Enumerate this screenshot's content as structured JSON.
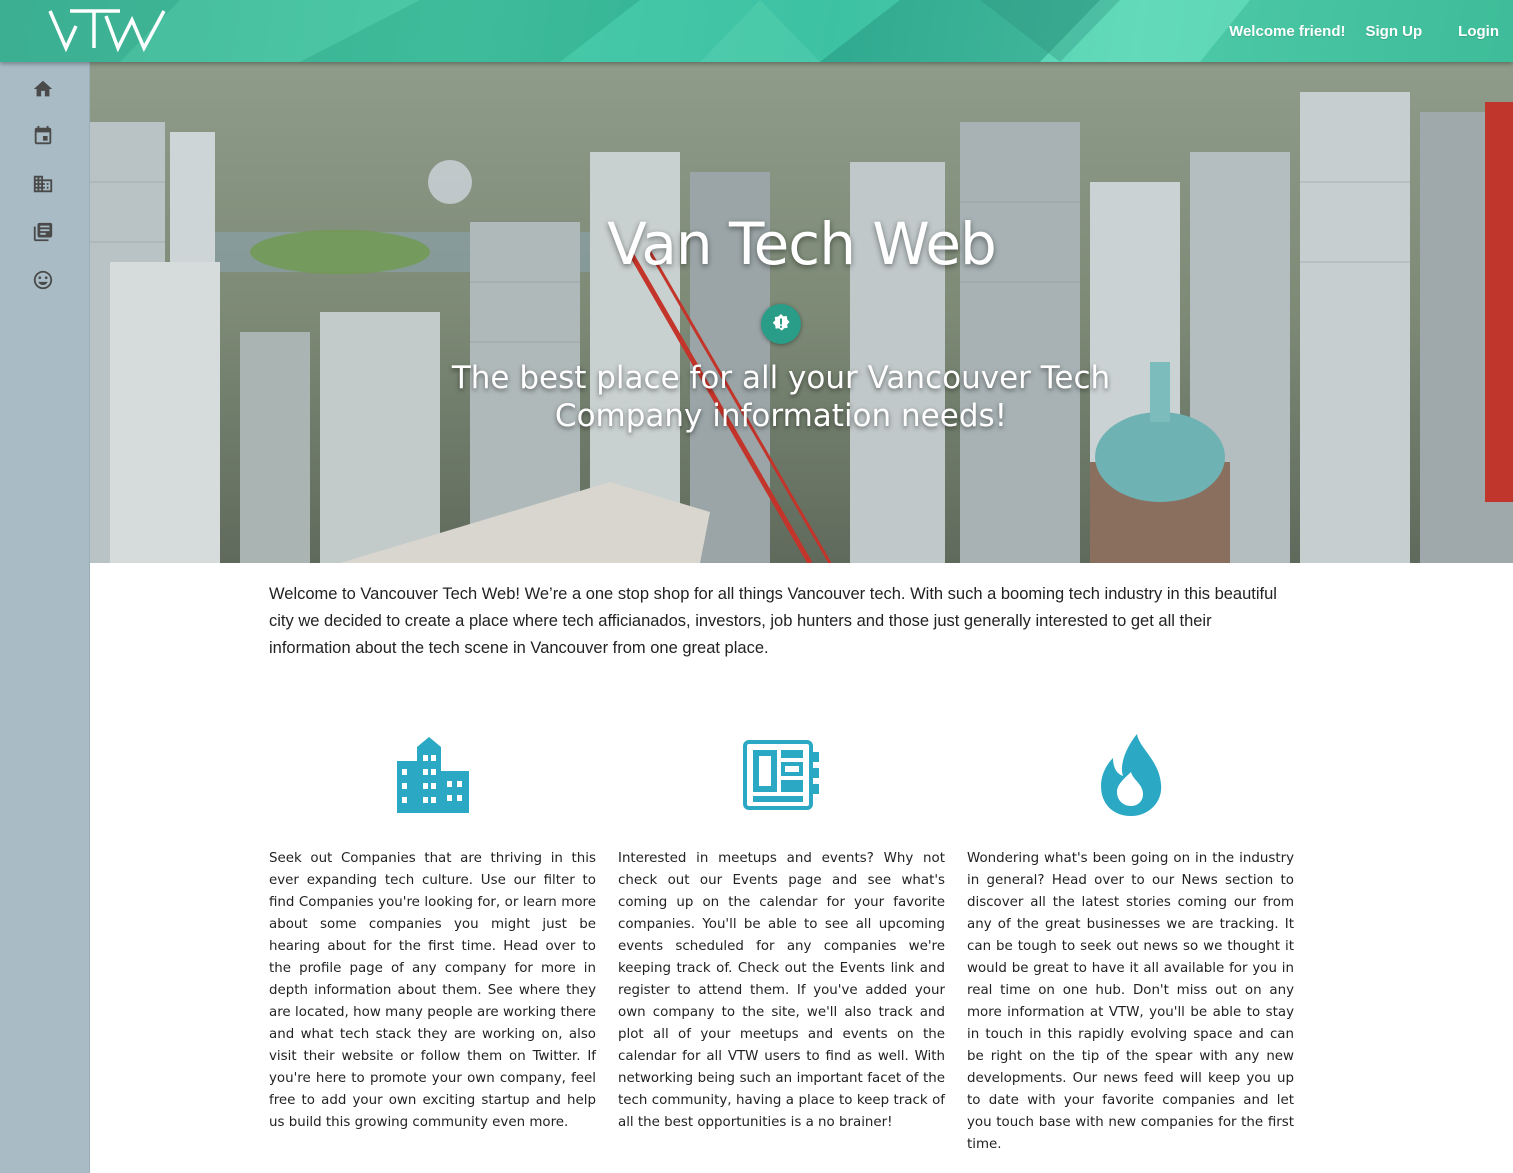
{
  "header": {
    "logo_text": "VTW",
    "welcome": "Welcome friend!",
    "signup": "Sign Up",
    "login": "Login"
  },
  "sidebar": {
    "items": [
      {
        "icon": "home-icon"
      },
      {
        "icon": "calendar-icon"
      },
      {
        "icon": "business-icon"
      },
      {
        "icon": "news-icon"
      },
      {
        "icon": "smiley-icon"
      }
    ]
  },
  "hero": {
    "title": "Van Tech Web",
    "subtitle": "The best place for all your Vancouver Tech Company information needs!"
  },
  "intro": {
    "text": "Welcome to Vancouver Tech Web! We’re a one stop shop for all things Vancouver tech. With such a booming tech industry in this beautiful city we decided to create a place where tech afficianados, investors, job hunters and those just generally interested to get all their information about the tech scene in Vancouver from one great place."
  },
  "features": [
    {
      "icon": "building-icon",
      "text": "Seek out Companies that are thriving in this ever expanding tech culture. Use our filter to find Companies you're looking for, or learn more about some companies you might just be hearing about for the first time. Head over to the profile page of any company for more in depth information about them. See where they are located, how many people are working there and what tech stack they are working on, also visit their website or follow them on Twitter. If you're here to promote your own company, feel free to add your own exciting startup and help us build this growing community even more."
    },
    {
      "icon": "newspaper-icon",
      "text": "Interested in meetups and events? Why not check out our Events page and see what's coming up on the calendar for your favorite companies. You'll be able to see all upcoming events scheduled for any companies we're keeping track of. Check out the Events link and register to attend them. If you've added your own company to the site, we'll also track and plot all of your meetups and events on the calendar for all VTW users to find as well. With networking being such an important facet of the tech community, having a place to keep track of all the best opportunities is a no brainer!"
    },
    {
      "icon": "fire-icon",
      "text": "Wondering what's been going on in the industry in general? Head over to our News section to discover all the latest stories coming our from any of the great businesses we are tracking. It can be tough to seek out news so we thought it would be great to have it all available for you in real time on one hub. Don't miss out on any more information at VTW, you'll be able to stay in touch in this rapidly evolving space and can be right on the tip of the spear with any new developments. Our news feed will keep you up to date with your favorite companies and let you touch base with new companies for the first time."
    }
  ],
  "colors": {
    "accent": "#2aa8c4",
    "header": "#45c8a4",
    "sidebar": "#a9bcc6",
    "badge": "#2a9d89"
  }
}
